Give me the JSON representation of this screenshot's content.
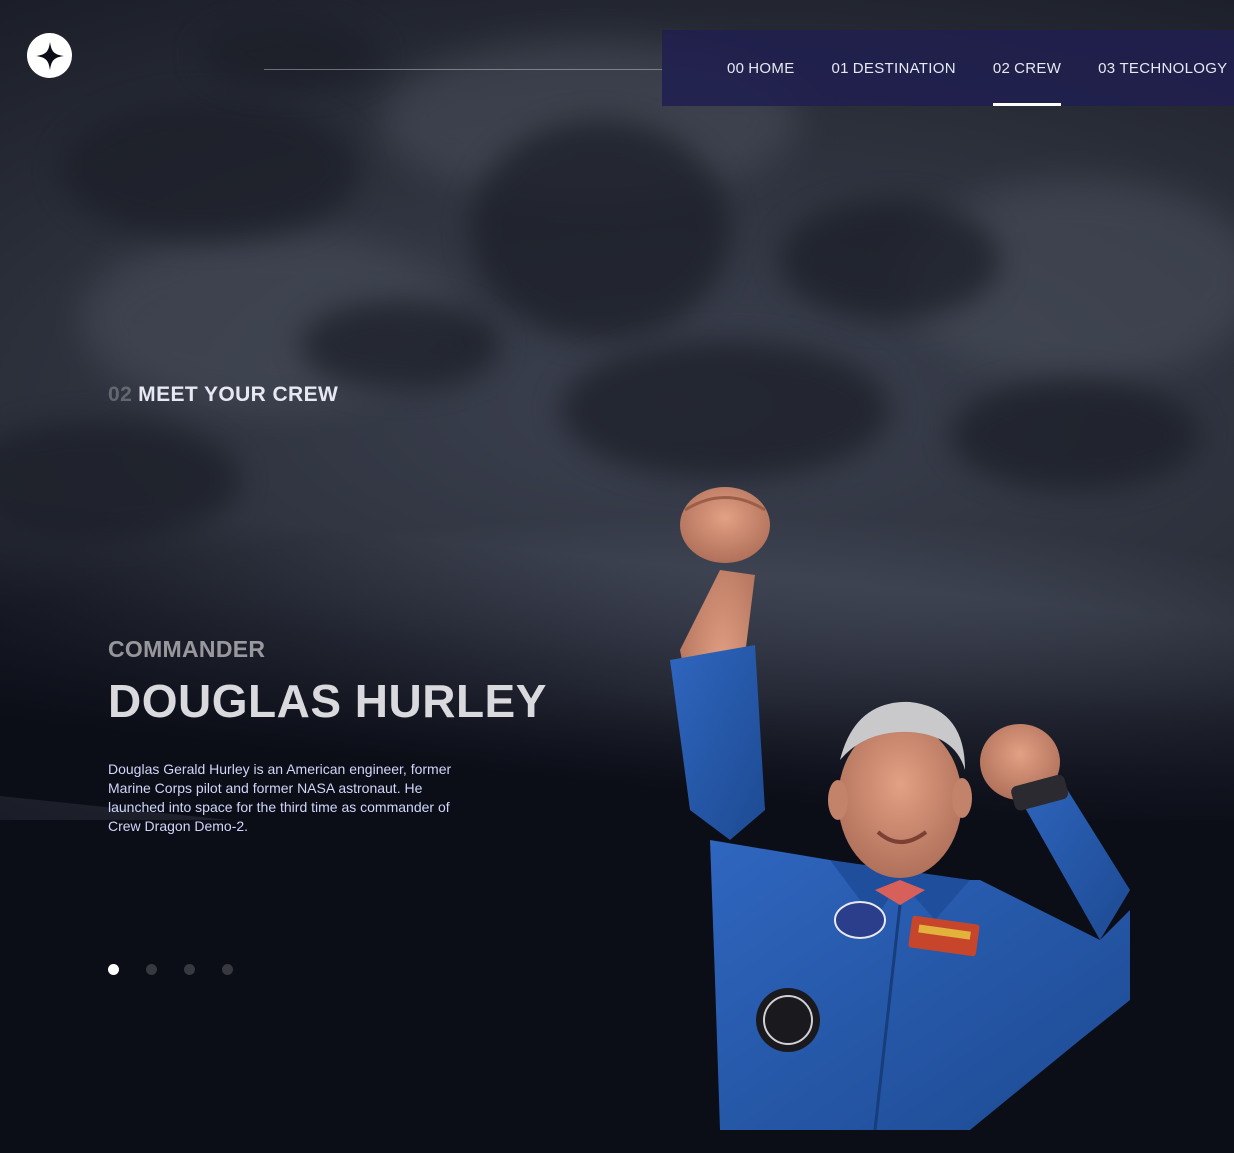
{
  "nav": {
    "items": [
      {
        "number": "00",
        "label": "HOME",
        "active": false
      },
      {
        "number": "01",
        "label": "DESTINATION",
        "active": false
      },
      {
        "number": "02",
        "label": "CREW",
        "active": true
      },
      {
        "number": "03",
        "label": "TECHNOLOGY",
        "active": false
      }
    ]
  },
  "crew": {
    "heading_number": "02",
    "heading_text": "MEET YOUR CREW",
    "role": "COMMANDER",
    "name": "DOUGLAS HURLEY",
    "bio": "Douglas Gerald Hurley is an American engineer, former Marine Corps pilot and former NASA astronaut. He launched into space for the third time as commander of Crew Dragon Demo-2.",
    "slides": {
      "count": 4,
      "active_index": 0
    }
  },
  "colors": {
    "background": "#0b0d17",
    "nav_background": "#201e50",
    "text_light": "#d0d6f9",
    "suit_blue": "#2456a8"
  },
  "icons": {
    "logo": "star-logo-icon"
  }
}
